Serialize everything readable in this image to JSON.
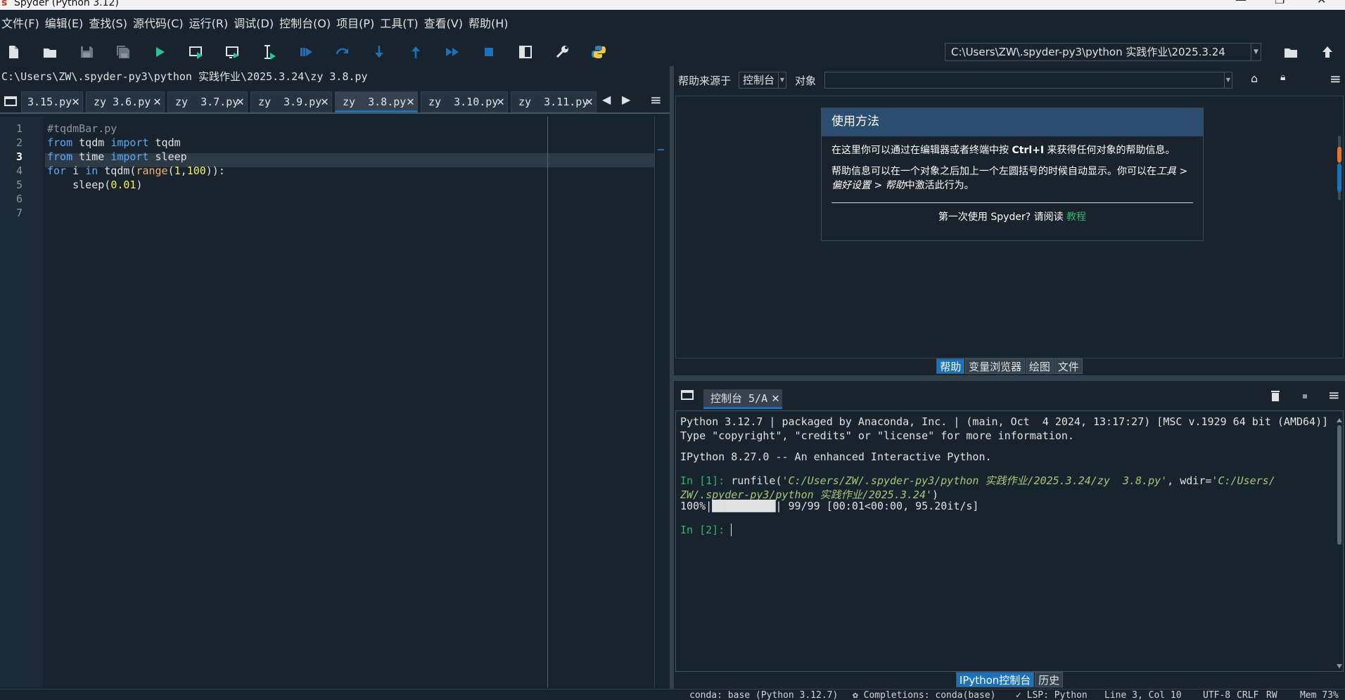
{
  "window": {
    "title": "Spyder (Python 3.12)"
  },
  "menu": [
    "文件(F)",
    "编辑(E)",
    "查找(S)",
    "源代码(C)",
    "运行(R)",
    "调试(D)",
    "控制台(O)",
    "项目(P)",
    "工具(T)",
    "查看(V)",
    "帮助(H)"
  ],
  "toolbar": {
    "icons": [
      "new-file-icon",
      "open-file-icon",
      "save-icon",
      "save-all-icon",
      "run-icon",
      "run-cell-icon",
      "run-cell-advance-icon",
      "run-selection-icon",
      "debug-icon",
      "step-over-icon",
      "step-into-icon",
      "step-return-icon",
      "continue-icon",
      "stop-icon",
      "maximize-pane-icon",
      "preferences-icon",
      "python-path-icon"
    ],
    "working_dir": "C:\\Users\\ZW\\.spyder-py3\\python 实践作业\\2025.3.24"
  },
  "editor": {
    "path": "C:\\Users\\ZW\\.spyder-py3\\python 实践作业\\2025.3.24\\zy  3.8.py",
    "tabs": [
      "3.15.py",
      "zy 3.6.py",
      "zy  3.7.py",
      "zy  3.9.py",
      "zy  3.8.py",
      "zy  3.10.py",
      "zy  3.11.py"
    ],
    "active_tab": "zy  3.8.py",
    "line_numbers": [
      "1",
      "2",
      "3",
      "4",
      "5",
      "6",
      "7"
    ],
    "current_line": "3",
    "code": {
      "l1": "#tqdmBar.py",
      "l2_a": "from",
      "l2_b": " tqdm ",
      "l2_c": "import",
      "l2_d": " tqdm",
      "l3_a": "from",
      "l3_b": " time ",
      "l3_c": "import",
      "l3_d": " sleep",
      "l4_a": "for",
      "l4_b": " i ",
      "l4_c": "in",
      "l4_d": " tqdm(",
      "l4_e": "range",
      "l4_f": "(",
      "l4_g": "1",
      "l4_h": ",",
      "l4_i": "100",
      "l4_j": ")):",
      "l5_a": "    sleep(",
      "l5_b": "0.01",
      "l5_c": ")"
    }
  },
  "help": {
    "source_label": "帮助来源于",
    "source_value": "控制台",
    "object_label": "对象",
    "object_value": "",
    "box_title": "使用方法",
    "para1_a": "在这里你可以通过在编辑器或者终端中按 ",
    "para1_b": "Ctrl+I",
    "para1_c": " 来获得任何对象的帮助信息。",
    "para2_a": "帮助信息可以在一个对象之后加上一个左圆括号的时候自动显示。你可以在",
    "para2_b": "工具 > 偏好设置 > 帮助",
    "para2_c": "中激活此行为。",
    "para3_a": "第一次使用 Spyder? 请阅读 ",
    "para3_link": "教程",
    "tabs": [
      "帮助",
      "变量浏览器",
      "绘图",
      "文件"
    ]
  },
  "console": {
    "tab_label": "控制台 5/A",
    "line1": "Python 3.12.7 | packaged by Anaconda, Inc. | (main, Oct  4 2024, 13:17:27) [MSC v.1929 64 bit (AMD64)]",
    "line2": "Type \"copyright\", \"credits\" or \"license\" for more information.",
    "line3": "IPython 8.27.0 -- An enhanced Interactive Python.",
    "prompt1": "In [1]: ",
    "run_a": "runfile(",
    "run_b": "'C:/Users/ZW/.spyder-py3/python 实践作业/2025.3.24/zy  3.8.py'",
    "run_c": ", wdir=",
    "run_d": "'C:/Users/",
    "run_e": "ZW/.spyder-py3/python 实践作业/2025.3.24'",
    "run_f": ")",
    "progress_a": "100%|",
    "progress_b": "██████████",
    "progress_c": "| 99/99 [00:01<00:00, 95.20it/s]",
    "prompt2": "In [2]: ",
    "tabs": [
      "IPython控制台",
      "历史"
    ]
  },
  "status": {
    "conda": "conda: base (Python 3.12.7)",
    "completions": "✿ Completions: conda(base)",
    "lsp": "✓ LSP: Python",
    "position": "Line 3, Col 10",
    "encoding": "UTF-8",
    "eol": "CRLF",
    "rw": "RW",
    "mem": "Mem 73%"
  },
  "colors": {
    "accent": "#1a72bb",
    "background": "#19232d",
    "keyword": "#55aaff",
    "number": "#faed5c",
    "prompt": "#2fb86b"
  }
}
